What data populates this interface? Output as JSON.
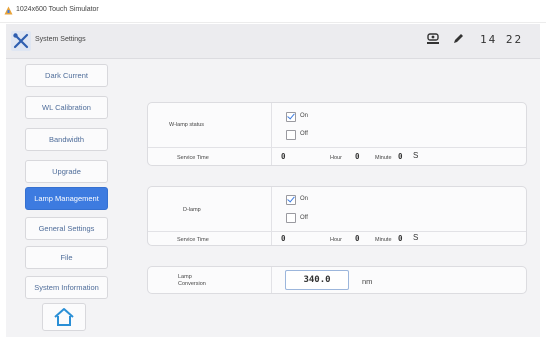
{
  "titlebar": {
    "app_title": "1024x600 Touch Simulator"
  },
  "header": {
    "title": "System Settings",
    "clock": "14 22"
  },
  "sidebar": {
    "items": [
      {
        "label": "Dark Current"
      },
      {
        "label": "WL Calibration"
      },
      {
        "label": "Bandwidth"
      },
      {
        "label": "Upgrade"
      },
      {
        "label": "Lamp Management",
        "selected": true
      },
      {
        "label": "General Settings"
      },
      {
        "label": "File"
      },
      {
        "label": "System Information"
      }
    ]
  },
  "lamps": [
    {
      "name": "W-lamp status",
      "option_on": "On",
      "option_off": "Off",
      "on_checked": true,
      "service_time_label": "Service Time",
      "hours": "0",
      "hour_label": "Hour",
      "minutes": "0",
      "minute_label": "Minute",
      "seconds": "0",
      "seconds_label": "S"
    },
    {
      "name": "D-lamp",
      "option_on": "On",
      "option_off": "Off",
      "on_checked": true,
      "service_time_label": "Service Time",
      "hours": "0",
      "hour_label": "Hour",
      "minutes": "0",
      "minute_label": "Minute",
      "seconds": "0",
      "seconds_label": "S"
    }
  ],
  "conversion": {
    "label_line1": "Lamp",
    "label_line2": "Conversion",
    "value": "340.0",
    "unit": "nm"
  },
  "colors": {
    "accent": "#3d7be0",
    "nav_text": "#4f6d9a"
  }
}
